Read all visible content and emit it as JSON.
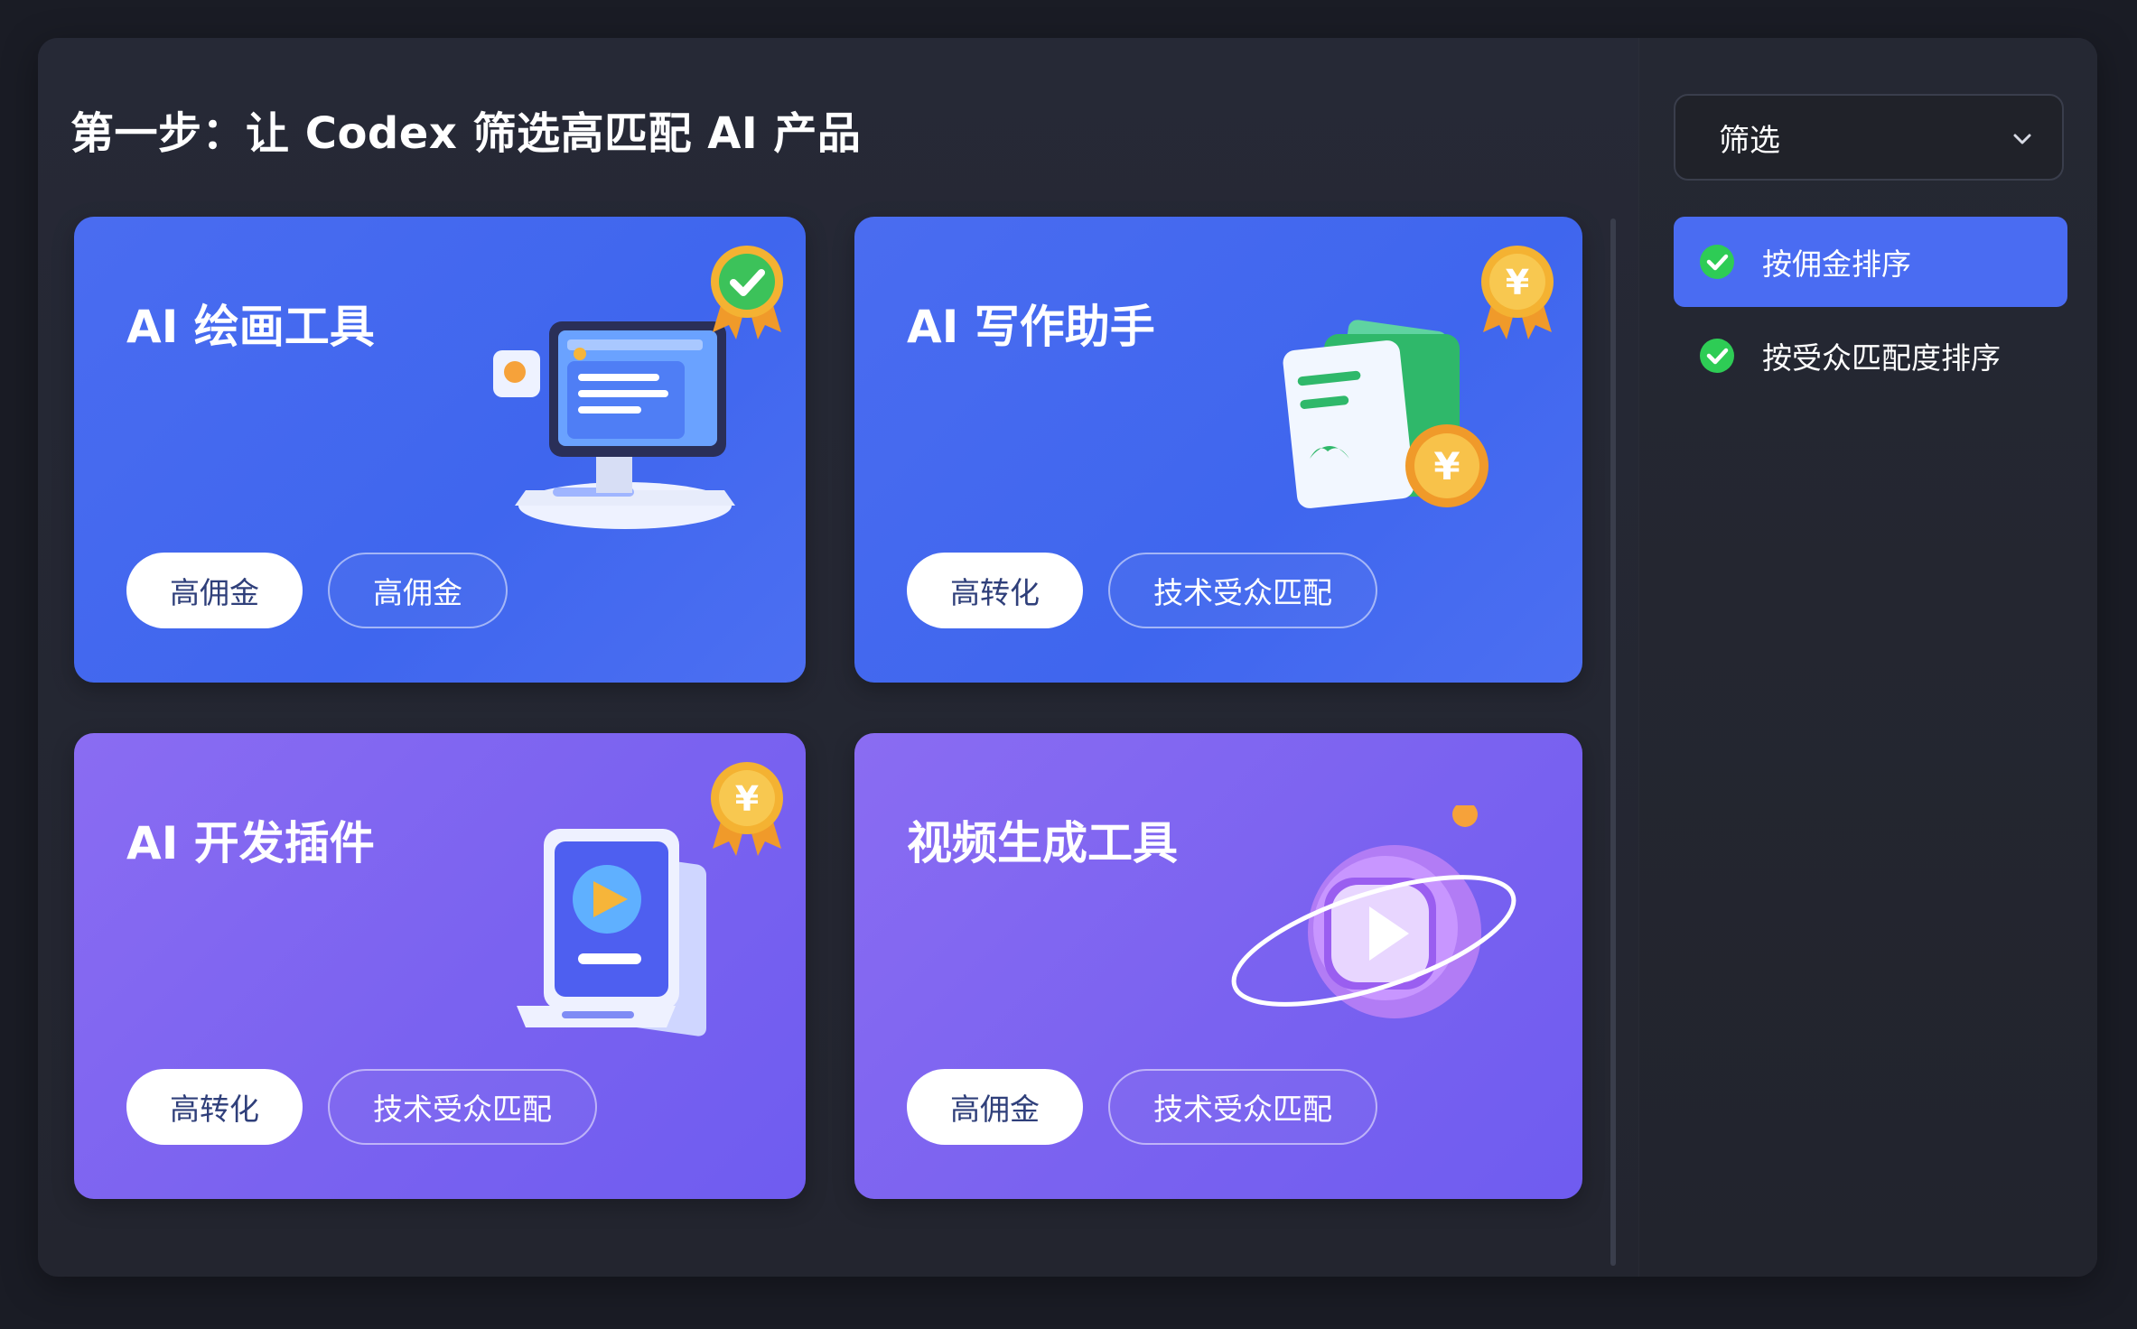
{
  "page": {
    "title": "第一步：让 Codex 筛选高匹配 AI 产品"
  },
  "cards": [
    {
      "title": "AI 绘画工具",
      "tags": [
        "高佣金",
        "高佣金"
      ],
      "badge_icon": "check-medal-icon",
      "illustration": "monitor-icon"
    },
    {
      "title": "AI 写作助手",
      "tags": [
        "高转化",
        "技术受众匹配"
      ],
      "badge_icon": "yuan-medal-icon",
      "illustration": "document-wallet-coin-icon"
    },
    {
      "title": "AI 开发插件",
      "tags": [
        "高转化",
        "技术受众匹配"
      ],
      "badge_icon": "yuan-medal-icon",
      "illustration": "tablet-device-icon"
    },
    {
      "title": "视频生成工具",
      "tags": [
        "高佣金",
        "技术受众匹配"
      ],
      "badge_icon": "none",
      "illustration": "play-planet-icon"
    }
  ],
  "sidebar": {
    "filter_label": "筛选",
    "options": [
      {
        "label": "按佣金排序",
        "active": true
      },
      {
        "label": "按受众匹配度排序",
        "active": false
      }
    ]
  },
  "colors": {
    "background": "#1a1c25",
    "panel": "#262936",
    "card_blue": "#4a6cf0",
    "card_purple": "#7a62f0",
    "accent": "#4a6cf2",
    "check_green": "#2ecc55",
    "medal_gold": "#f4b232"
  }
}
